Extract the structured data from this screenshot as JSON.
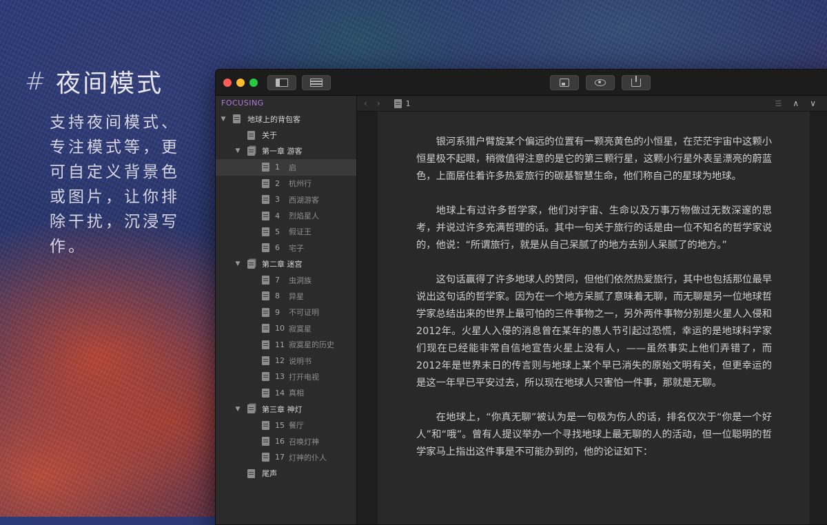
{
  "promo": {
    "hash": "#",
    "title": "夜间模式",
    "description": "支持夜间模式、专注模式等，更可自定义背景色或图片，让你排除干扰，沉浸写作。"
  },
  "window": {
    "sidebar": {
      "mode_label": "FOCUSING",
      "tree": [
        {
          "type": "book",
          "label": "地球上的背包客"
        },
        {
          "type": "doc",
          "label": "关于"
        },
        {
          "type": "chapter",
          "label": "第一章 游客"
        },
        {
          "type": "section",
          "num": "1",
          "label": "启",
          "selected": true
        },
        {
          "type": "section",
          "num": "2",
          "label": "杭州行"
        },
        {
          "type": "section",
          "num": "3",
          "label": "西湖游客"
        },
        {
          "type": "section",
          "num": "4",
          "label": "烈焰星人"
        },
        {
          "type": "section",
          "num": "5",
          "label": "假证王"
        },
        {
          "type": "section",
          "num": "6",
          "label": "宅子"
        },
        {
          "type": "chapter",
          "label": "第二章 迷宫"
        },
        {
          "type": "section",
          "num": "7",
          "label": "虫洞族"
        },
        {
          "type": "section",
          "num": "8",
          "label": "异星"
        },
        {
          "type": "section",
          "num": "9",
          "label": "不可证明"
        },
        {
          "type": "section",
          "num": "10",
          "label": "寂寞星"
        },
        {
          "type": "section",
          "num": "11",
          "label": "寂寞星的历史"
        },
        {
          "type": "section",
          "num": "12",
          "label": "说明书"
        },
        {
          "type": "section",
          "num": "13",
          "label": "打开电视"
        },
        {
          "type": "section",
          "num": "14",
          "label": "真相"
        },
        {
          "type": "chapter",
          "label": "第三章 神灯"
        },
        {
          "type": "section",
          "num": "15",
          "label": "餐厅"
        },
        {
          "type": "section",
          "num": "16",
          "label": "召唤灯神"
        },
        {
          "type": "section",
          "num": "17",
          "label": "灯神的仆人"
        },
        {
          "type": "doc",
          "label": "尾声"
        }
      ]
    },
    "navbar": {
      "back": "‹",
      "forward": "›",
      "current_page": "1",
      "up": "∧",
      "down": "∨"
    },
    "editor": {
      "paragraphs": [
        "银河系猎户臂旋某个偏远的位置有一颗亮黄色的小恒星，在茫茫宇宙中这颗小恒星极不起眼，稍微值得注意的是它的第三颗行星，这颗小行星外表呈漂亮的蔚蓝色，上面居住着许多热爱旅行的碳基智慧生命，他们称自己的星球为地球。",
        "地球上有过许多哲学家，他们对宇宙、生命以及万事万物做过无数深邃的思考，并说过许多充满哲理的话。其中一句关于旅行的话是由一位不知名的哲学家说的，他说：“所谓旅行，就是从自己呆腻了的地方去别人呆腻了的地方。”",
        "这句话赢得了许多地球人的赞同，但他们依然热爱旅行，其中也包括那位最早说出这句话的哲学家。因为在一个地方呆腻了意味着无聊，而无聊是另一位地球哲学家总结出来的世界上最可怕的三件事物之一，另外两件事物分别是火星人入侵和2012年。火星人入侵的消息曾在某年的愚人节引起过恐慌，幸运的是地球科学家们现在已经能非常自信地宣告火星上没有人，——虽然事实上他们弄错了，而2012年是世界末日的传言则与地球上某个早已消失的原始文明有关，但更幸运的是这一年早已平安过去，所以现在地球人只害怕一件事，那就是无聊。",
        "在地球上，“你真无聊”被认为是一句极为伤人的话，排名仅次于“你是一个好人”和“哦”。曾有人提议举办一个寻找地球上最无聊的人的活动，但一位聪明的哲学家马上指出这件事是不可能办到的，他的论证如下："
      ]
    }
  },
  "colors": {
    "focus_label": "#b27adf",
    "window_bg": "#262626",
    "page_bg": "#292929",
    "text": "#cfcfcf"
  }
}
